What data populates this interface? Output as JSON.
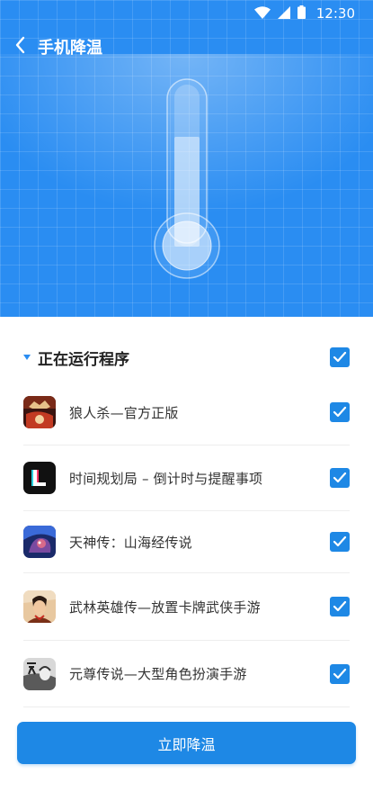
{
  "status_bar": {
    "time": "12:30"
  },
  "header": {
    "title": "手机降温"
  },
  "section": {
    "title": "正在运行程序"
  },
  "apps": [
    {
      "name": "狼人杀—官方正版"
    },
    {
      "name": "时间规划局 – 倒计时与提醒事项"
    },
    {
      "name": "天神传：山海经传说"
    },
    {
      "name": "武林英雄传—放置卡牌武侠手游"
    },
    {
      "name": "元尊传说—大型角色扮演手游"
    }
  ],
  "cta": {
    "label": "立即降温"
  },
  "colors": {
    "primary": "#1e88e5",
    "hero": "#2a8df2"
  }
}
